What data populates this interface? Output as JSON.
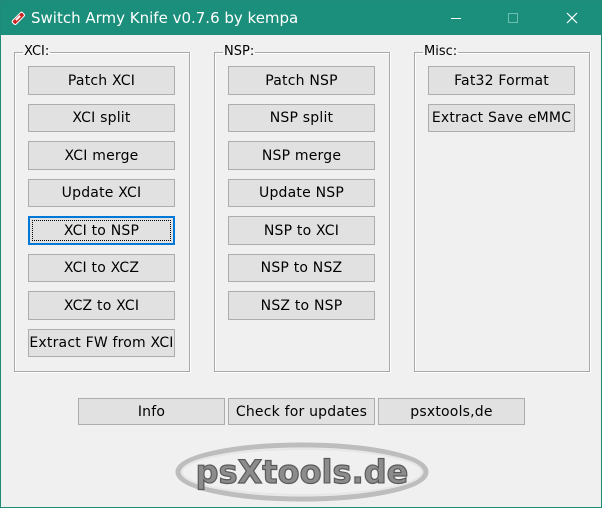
{
  "window": {
    "title": "Switch Army Knife v0.7.6 by kempa"
  },
  "xci_group": {
    "legend": "XCI:",
    "buttons": [
      "Patch XCI",
      "XCI split",
      "XCI merge",
      "Update XCI",
      "XCI to NSP",
      "XCI to XCZ",
      "XCZ to XCI",
      "Extract FW from XCI"
    ]
  },
  "nsp_group": {
    "legend": "NSP:",
    "buttons": [
      "Patch NSP",
      "NSP split",
      "NSP merge",
      "Update NSP",
      "NSP to XCI",
      "NSP to NSZ",
      "NSZ to NSP"
    ]
  },
  "misc_group": {
    "legend": "Misc:",
    "buttons": [
      "Fat32 Format",
      "Extract Save eMMC"
    ]
  },
  "footer": {
    "buttons": [
      "Info",
      "Check for updates",
      "psxtools,de"
    ]
  },
  "logo": {
    "text": "psXtools.de"
  },
  "colors": {
    "titlebar": "#1b8f7b",
    "button_face": "#e1e1e1",
    "focus": "#0078d7"
  }
}
